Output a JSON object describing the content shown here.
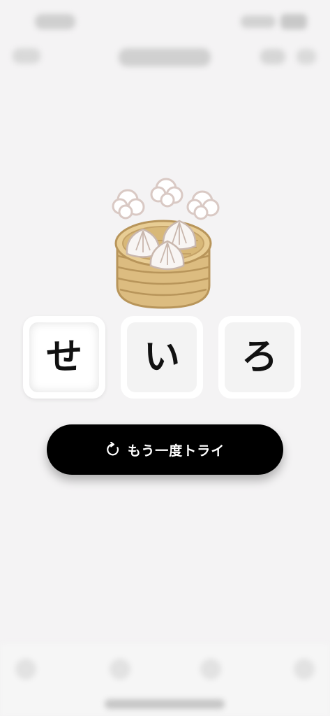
{
  "quiz": {
    "image_subject": "steamer-basket-with-buns",
    "tiles": [
      {
        "label": "せ",
        "state": "selected"
      },
      {
        "label": "い",
        "state": "normal"
      },
      {
        "label": "ろ",
        "state": "normal"
      }
    ],
    "retry_label": "もう一度トライ",
    "retry_icon": "retry-icon"
  },
  "colors": {
    "background": "#f4f3f4",
    "button": "#000000",
    "button_text": "#ffffff",
    "tile": "#ffffff",
    "bamboo": "#e2c58f",
    "bun": "#f7f3f0"
  }
}
